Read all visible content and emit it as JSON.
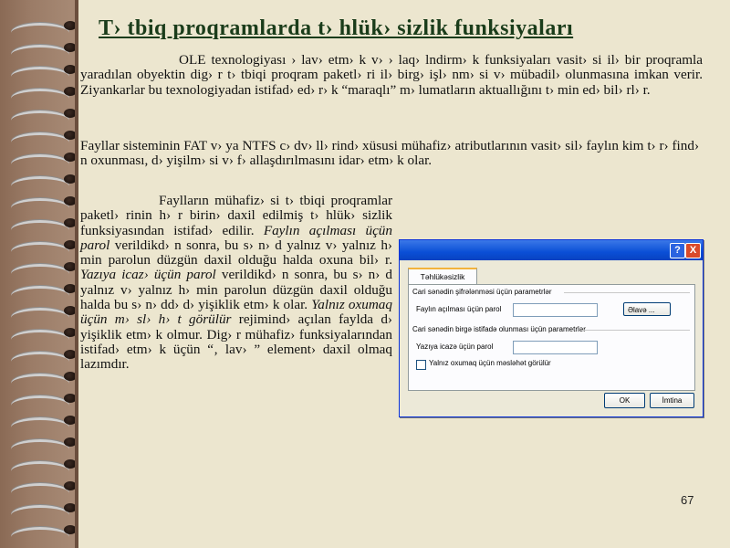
{
  "title": "T› tbiq proqramlarda t› hlük› sizlik funksiyaları",
  "paragraphs": {
    "p1": "OLE texnologiyası › lav›   etm› k v›   › laq› lndirm› k funksiyaları vasit› si il›   bir proqramla   yaradılan obyektin dig› r   t› tbiqi proqram paketl› ri il›   birg›   işl› nm› si v›   mübadil›   olunmasına imkan verir. Ziyankarlar bu texnologiyadan istifad›   ed› r› k “maraqlı” m› lumatların aktuallığını t› min ed›  bil› rl› r.",
    "p2": "Fayllar sisteminin FAT v›   ya   NTFS c› dv› ll› rind›   xüsusi mühafiz› atributlarının vasit› sil›    faylın kim t› r› find› n oxunması, d› yişilm› si v› f› allaşdırılmasını idar›  etm› k olar.",
    "p3_intro": "Faylların mühafiz› si t› tbiqi proqramlar paketl› rinin h› r birin› daxil edilmiş t› hlük› sizlik funksiyasından istifad›  edilir. ",
    "p3_em1": "Faylın açılması üçün parol",
    "p3_mid1": " verildikd› n sonra, bu s› n› d yalnız v›  yalnız h› min parolun düzgün daxil olduğu halda oxuna bil› r. ",
    "p3_em2": "Yazıya icaz›  üçün parol",
    "p3_mid2": " verildikd› n sonra, bu s› n› d yalnız v›  yalnız h› min parolun düzgün daxil olduğu halda bu s› n› dd›  d› yişiklik etm› k olar. ",
    "p3_em3": "Yalnız oxumaq üçün m› sl› h› t görülür",
    "p3_end": " rejimind›  açılan faylda d› yişiklik etm› k olmur. Dig› r mühafiz›  funksiyalarından istifad› etm› k üçün “‚ lav› ” element› daxil olmaq lazımdır."
  },
  "dialog": {
    "help_label": "?",
    "close_label": "X",
    "tab_label": "Təhlükəsizlik",
    "section1": "Cari sənədin şifrələnməsi üçün parametrlər",
    "open_password_label": "Faylın açılması üçün parol",
    "add_button": "Əlavə ...",
    "section2": "Cari sənədin birgə istifadə olunması üçün parametrlər",
    "write_password_label": "Yazıya icazə üçün parol",
    "readonly_label": "Yalnız oxumaq üçün məsləhət görülür",
    "ok_button": "OK",
    "cancel_button": "İmtina"
  },
  "page_number": "67",
  "colors": {
    "title": "#1a3c1a",
    "background": "#ece6cf",
    "binding": "#9b7c67"
  }
}
